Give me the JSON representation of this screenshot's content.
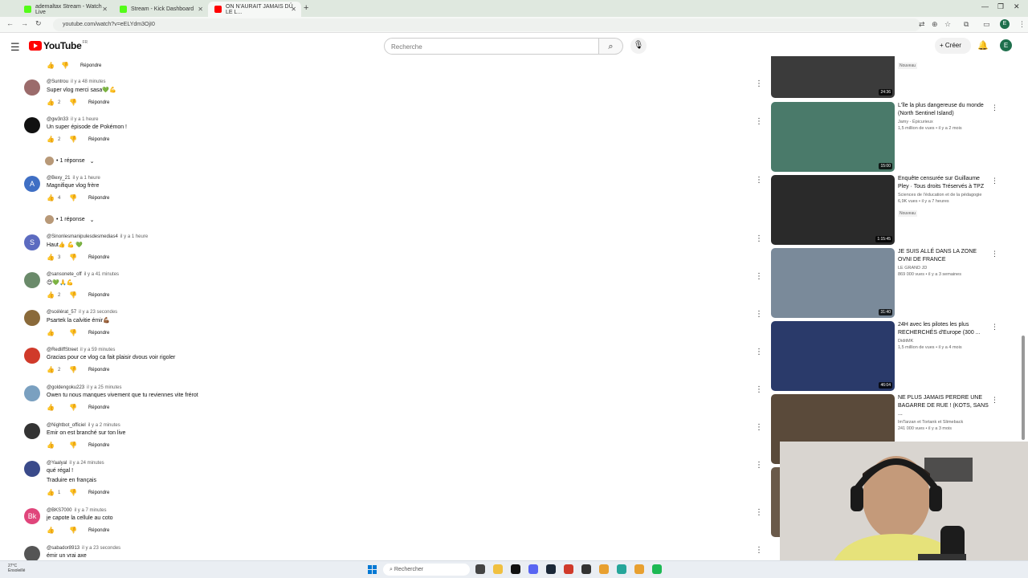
{
  "browser": {
    "tabs": [
      {
        "title": "ademaltax Stream - Watch Live",
        "color": "#53fc18"
      },
      {
        "title": "Stream - Kick Dashboard",
        "color": "#53fc18"
      },
      {
        "title": "ON N'AURAIT JAMAIS DÛ LE L...",
        "color": "#ff0000"
      }
    ],
    "url": "youtube.com/watch?v=eELYdm3OjI0",
    "profile_letter": "E"
  },
  "youtube": {
    "logo_text": "YouTube",
    "logo_country": "FR",
    "search_placeholder": "Recherche",
    "create_label": "Créer",
    "avatar_letter": "E"
  },
  "comments": {
    "top_reply_label": "Répondre",
    "items": [
      {
        "author": "@Suntrou",
        "time": "il y a 48 minutes",
        "text": "Super vlog merci sasa💚💪",
        "likes": "2",
        "reply": "Répondre",
        "avatar_color": "#9b6b6b",
        "avatar_letter": ""
      },
      {
        "author": "@gw3n33",
        "time": "il y a 1 heure",
        "text": "Un super épisode de Pokémon !",
        "likes": "2",
        "reply": "Répondre",
        "avatar_color": "#111111",
        "avatar_letter": ""
      },
      {
        "author": "@Bexy_21",
        "time": "il y a 1 heure",
        "text": "Magnifique vlog frère",
        "likes": "4",
        "reply": "Répondre",
        "avatar_color": "#3f6fc4",
        "avatar_letter": "A"
      },
      {
        "author": "@Sinonlesmanipulesdesmedias4",
        "time": "il y a 1 heure",
        "text": "Haut👍 💪 💚",
        "likes": "3",
        "reply": "Répondre",
        "avatar_color": "#5c6bc0",
        "avatar_letter": "S"
      },
      {
        "author": "@sansonete_off",
        "time": "il y a 41 minutes",
        "text": "😊💚🙏💪",
        "likes": "2",
        "reply": "Répondre",
        "avatar_color": "#6a8a6a",
        "avatar_letter": ""
      },
      {
        "author": "@scélérat_57",
        "time": "il y a 23 secondes",
        "text": "Psartek la calvitie émir💪🏾",
        "likes": "",
        "reply": "Répondre",
        "avatar_color": "#8a6a3a",
        "avatar_letter": ""
      },
      {
        "author": "@RedliffStreet",
        "time": "il y a 59 minutes",
        "text": "Gracias pour ce vlog ca fait plaisir dvous voir rigoler",
        "likes": "2",
        "reply": "Répondre",
        "avatar_color": "#d03a2a",
        "avatar_letter": ""
      },
      {
        "author": "@goldengoku223",
        "time": "il y a 25 minutes",
        "text": "Owen tu nous manques vivement que tu reviennes vite frérot",
        "likes": "",
        "reply": "Répondre",
        "avatar_color": "#7aa0c0",
        "avatar_letter": ""
      },
      {
        "author": "@Nightbot_officiel",
        "time": "il y a 2 minutes",
        "text": "Emir on est branché sur ton live",
        "likes": "",
        "reply": "Répondre",
        "avatar_color": "#333333",
        "avatar_letter": ""
      },
      {
        "author": "@Yaalyal",
        "time": "il y a 24 minutes",
        "text": "qué régal !",
        "text2": "Traduire en français",
        "likes": "1",
        "reply": "Répondre",
        "avatar_color": "#3a4a8a",
        "avatar_letter": ""
      },
      {
        "author": "@BKS7000",
        "time": "il y a 7 minutes",
        "text": "je capote la cellule au coto",
        "likes": "",
        "reply": "Répondre",
        "avatar_color": "#e0457b",
        "avatar_letter": "Bk"
      },
      {
        "author": "@sabador8913",
        "time": "il y a 23 secondes",
        "text": "émir un vrai axe",
        "likes": "",
        "reply": "",
        "avatar_color": "#555555",
        "avatar_letter": ""
      }
    ],
    "replies_label": "1 réponse"
  },
  "recommended": [
    {
      "title": "",
      "channel": "",
      "meta": "",
      "badge": "Nouveau",
      "duration": "24:36",
      "thumb_color": "#3b3b3b"
    },
    {
      "title": "L'île la plus dangereuse du monde (North Sentinel Island)",
      "channel": "Jamy - Épicurieux",
      "meta": "1,5 million de vues • il y a 2 mois",
      "badge": "",
      "duration": "15:00",
      "thumb_color": "#4a7a6a"
    },
    {
      "title": "Enquête censurée sur Guillaume Pley · Tous droits Tréservés à TPZ",
      "channel": "Sciences de l'éducation et de la pédagogie",
      "meta": "6,9K vues • il y a 7 heures",
      "badge": "Nouveau",
      "duration": "1:15:45",
      "thumb_color": "#2a2a2a"
    },
    {
      "title": "JE SUIS ALLÉ DANS LA ZONE OVNI DE FRANCE",
      "channel": "LE GRAND JD",
      "meta": "869 000 vues • il y a 3 semaines",
      "badge": "",
      "duration": "31:40",
      "thumb_color": "#7a8a9a"
    },
    {
      "title": "24H avec les pilotes les plus RECHERCHÉS d'Europe (300 ...",
      "channel": "DiditMK",
      "meta": "1,5 million de vues • il y a 4 mois",
      "badge": "",
      "duration": "46:04",
      "thumb_color": "#2a3a6a"
    },
    {
      "title": "NE PLUS JAMAIS PERDRE UNE BAGARRE DE RUE ! (KOTS, SANS ...",
      "channel": "ImTarzan et Tortank et Slimeback",
      "meta": "241 000 vues • il y a 3 mois",
      "badge": "",
      "duration": "",
      "thumb_color": "#5a4a3a"
    }
  ],
  "taskbar": {
    "temperature": "27°C",
    "weather": "Ensoleillé",
    "search_label": "Rechercher"
  }
}
